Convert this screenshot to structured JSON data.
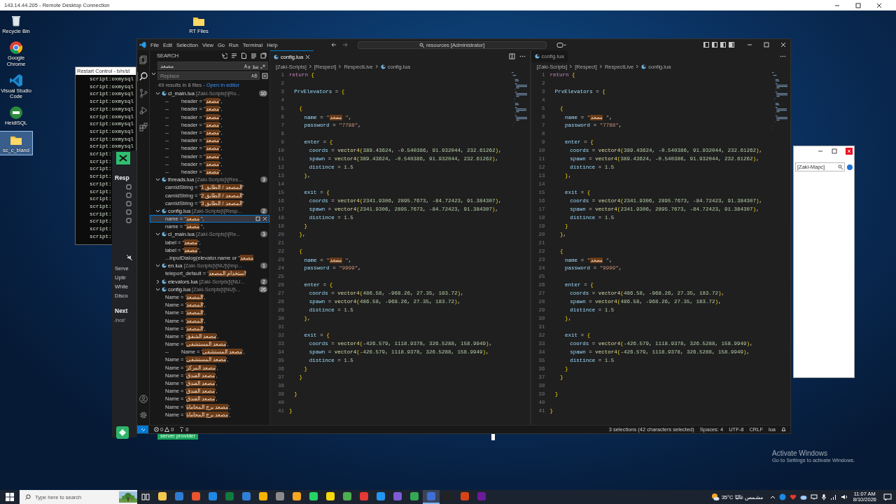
{
  "rdp": {
    "title": "143.14.44.205 - Remote Desktop Connection"
  },
  "desktop_icons": [
    {
      "label": "Recycle Bin",
      "kind": "recycle",
      "selected": false
    },
    {
      "label": "Google Chrome",
      "kind": "chrome",
      "selected": false
    },
    {
      "label": "Visual Studio Code",
      "kind": "vscode",
      "selected": false
    },
    {
      "label": "HeidiSQL",
      "kind": "heidi",
      "selected": false
    },
    {
      "label": "sc_c_bland",
      "kind": "folder",
      "selected": true
    }
  ],
  "desktop_folder": {
    "label": "RT Files"
  },
  "console_window": {
    "title": "Restart Control - b/n/st",
    "lines": [
      "script:oxmysql",
      "script:oxmysql",
      "script:oxmysql",
      "script:oxmysql",
      "script:oxmysql",
      "script:oxmysql",
      "script:oxmysql",
      "script:oxmysql",
      "script:oxmysql",
      "script:oxmysql",
      "script:",
      "script:",
      "script:",
      "script:",
      "script:",
      "script:",
      "script:",
      "script:",
      "script:",
      "script:",
      "script:",
      "script:"
    ]
  },
  "browser_window": {
    "heading": "Resp",
    "items": [
      "Serve",
      "Uptir",
      "White",
      "Disco"
    ],
    "next": "Next",
    "path": "/not/"
  },
  "provider_bar": {
    "label": "server provider"
  },
  "dialog_window": {
    "field_value": "[Zaki-Mapc]"
  },
  "vscode": {
    "menu": [
      "File",
      "Edit",
      "Selection",
      "View",
      "Go",
      "Run",
      "Terminal",
      "Help"
    ],
    "command_center": "resources [Administrator]",
    "activity": [
      {
        "kind": "explorer",
        "selected": false
      },
      {
        "kind": "search",
        "selected": true
      },
      {
        "kind": "scm",
        "selected": false
      },
      {
        "kind": "debug",
        "selected": false
      },
      {
        "kind": "extensions",
        "selected": false
      }
    ],
    "search": {
      "title": "SEARCH",
      "query": "مصعد",
      "replace_placeholder": "Replace",
      "summary": "49 results in 8 files - ",
      "open_link": "Open in editor",
      "files": [
        {
          "name": "cl_main.lua",
          "path": "[Zaki-Scripts]\\[Ro...",
          "count": "10",
          "expanded": true,
          "matches": [
            {
              "prefix": "--",
              "text": "header = \"مصعد\",",
              "selected": false
            },
            {
              "prefix": "--",
              "text": "header = \"مصعد\",",
              "selected": false
            },
            {
              "prefix": "--",
              "text": "header = \"مصعد\",",
              "selected": false
            },
            {
              "prefix": "--",
              "text": "header = \"مصعد\",",
              "selected": false
            },
            {
              "prefix": "--",
              "text": "header = \"مصعد\",",
              "selected": false
            },
            {
              "prefix": "--",
              "text": "header = \"مصعد\",",
              "selected": false
            },
            {
              "prefix": "--",
              "text": "header = \"مصعد\",",
              "selected": false
            },
            {
              "prefix": "--",
              "text": "header = \"مصعد\",",
              "selected": false
            },
            {
              "prefix": "--",
              "text": "header = \"مصعد\",",
              "selected": false
            },
            {
              "prefix": "--",
              "text": "header = \"مصعد\",",
              "selected": false
            }
          ]
        },
        {
          "name": "threads.lua",
          "path": "[Zaki-Scripts]\\[Res...",
          "count": "3",
          "expanded": true,
          "matches": [
            {
              "text": "camIdString = \"المصعد / الطابق 1\"",
              "selected": false
            },
            {
              "text": "camIdString = \"المصعد / الطابق 2\"",
              "selected": false
            },
            {
              "text": "camIdString = \"المصعد / الطابق 3\"",
              "selected": false
            }
          ]
        },
        {
          "name": "config.lua",
          "path": "[Zaki-Scripts]\\[Resp...",
          "count": "2",
          "expanded": true,
          "matches": [
            {
              "text": "name = \"مصعد \",",
              "selected": true
            },
            {
              "text": "name = \"مصعد \",",
              "selected": false
            }
          ]
        },
        {
          "name": "cl_main.lua",
          "path": "[Zaki-Scripts]\\[Re...",
          "count": "3",
          "expanded": true,
          "matches": [
            {
              "text": "label = \"مصعد\",",
              "selected": false
            },
            {
              "text": "label = \"مصعد\",",
              "selected": false
            },
            {
              "text": "...inputDialog(elevator.name or \"مصعد",
              "selected": false
            }
          ]
        },
        {
          "name": "en.lua",
          "path": "[Zaki-Scripts]\\[NU]\\[Imp...",
          "count": "1",
          "expanded": true,
          "matches": [
            {
              "text": "teleport_default = 'استخدام المصعد'",
              "selected": false
            }
          ]
        },
        {
          "name": "elevators.lua",
          "path": "[Zaki-Scripts]\\[NU...",
          "count": "2",
          "expanded": false
        },
        {
          "name": "config.lua",
          "path": "[Zaki-Scripts]\\[NU]\\...",
          "count": "26",
          "expanded": true,
          "matches": [
            {
              "text": "Name = 'المصعد',",
              "selected": false
            },
            {
              "text": "Name = 'المصعد',",
              "selected": false
            },
            {
              "text": "Name = 'المصعد',",
              "selected": false
            },
            {
              "text": "Name = 'المصعد',",
              "selected": false
            },
            {
              "text": "Name = 'المصعد',",
              "selected": false
            },
            {
              "text": "Name = 'مصعد الشقق',",
              "selected": false
            },
            {
              "text": "Name = 'مصعد المستشفى',",
              "selected": false
            },
            {
              "prefix": "--",
              "text": "Name = 'مصعد المستشفى',",
              "selected": false
            },
            {
              "text": "Name = 'مصعد المستشفى',",
              "selected": false
            },
            {
              "text": "Name = 'مصعد المركز',",
              "selected": false
            },
            {
              "text": "Name = 'مصعد الفندق',",
              "selected": false
            },
            {
              "text": "Name = 'مصعد الفندق',",
              "selected": false
            },
            {
              "text": "Name = 'مصعد الفندق',",
              "selected": false
            },
            {
              "text": "Name = 'مصعد الفندق',",
              "selected": false
            },
            {
              "text": "Name = 'مصعد برج المحاماة',",
              "selected": false
            },
            {
              "text": "Name = 'مصعد برج المحاماة',",
              "selected": false
            }
          ]
        }
      ]
    },
    "editors": [
      {
        "tab": {
          "label": "config.lua",
          "selected": true
        },
        "breadcrumbs": [
          "[Zaki-Scripts]",
          "[Respect]",
          "RespectLive",
          "config.lua"
        ],
        "lines": [
          {
            "n": "1",
            "code": "return {"
          },
          {
            "n": "2"
          },
          {
            "n": "3",
            "code": "    PrvElevators = {"
          },
          {
            "n": "4"
          },
          {
            "n": "5",
            "code": "        {"
          },
          {
            "n": "6",
            "code": "            name = \"مصعد \","
          },
          {
            "n": "7",
            "code": "            password = \"7788\","
          },
          {
            "n": "8"
          },
          {
            "n": "9",
            "code": "            enter = {"
          },
          {
            "n": "10",
            "code": "                coords = vector4(389.43624, -0.540386, 91.932044, 232.61262),"
          },
          {
            "n": "11",
            "code": "                spawn = vector4(389.43624, -0.540386, 91.932044, 232.61262),"
          },
          {
            "n": "12",
            "code": "                distince = 1.5"
          },
          {
            "n": "13",
            "code": "            },"
          },
          {
            "n": "14"
          },
          {
            "n": "15",
            "code": "            exit = {"
          },
          {
            "n": "16",
            "code": "                coords = vector4(2341.9306, 2895.7673, -84.72423, 91.384307),"
          },
          {
            "n": "17",
            "code": "                spawn = vector4(2341.9306, 2895.7673, -84.72423, 91.384307),"
          },
          {
            "n": "18",
            "code": "                distince = 1.5"
          },
          {
            "n": "19",
            "code": "            }"
          },
          {
            "n": "20",
            "code": "        },"
          },
          {
            "n": "21"
          },
          {
            "n": "22",
            "code": "        {"
          },
          {
            "n": "23",
            "code": "            name = \"مصعد \","
          },
          {
            "n": "24",
            "code": "            password = \"9999\","
          },
          {
            "n": "25"
          },
          {
            "n": "26",
            "code": "            enter = {"
          },
          {
            "n": "27",
            "code": "                coords = vector4(486.58, -968.26, 27.35, 183.72),"
          },
          {
            "n": "28",
            "code": "                spawn = vector4(486.58, -968.26, 27.35, 183.72),"
          },
          {
            "n": "29",
            "code": "                distince = 1.5"
          },
          {
            "n": "30",
            "code": "            },"
          },
          {
            "n": "31"
          },
          {
            "n": "32",
            "code": "            exit = {"
          },
          {
            "n": "33",
            "code": "                coords = vector4(-426.579, 1118.9378, 326.5288, 158.9949),"
          },
          {
            "n": "34",
            "code": "                spawn = vector4(-426.579, 1118.9378, 326.5288, 158.9949),"
          },
          {
            "n": "35",
            "code": "                distince = 1.5"
          },
          {
            "n": "36",
            "code": "            }"
          },
          {
            "n": "37",
            "code": "        }"
          },
          {
            "n": "38"
          },
          {
            "n": "39",
            "code": "    }"
          },
          {
            "n": "40"
          },
          {
            "n": "41",
            "code": "}"
          }
        ]
      },
      {
        "tab": {
          "label": "config.lua",
          "selected": false
        },
        "breadcrumbs": [
          "[Zaki-Scripts]",
          "[Respect]",
          "RespectLive",
          "config.lua"
        ],
        "lines": [
          {
            "n": "1",
            "code": "return {"
          },
          {
            "n": "2"
          },
          {
            "n": "3",
            "code": "    PrvElevators = {"
          },
          {
            "n": "4"
          },
          {
            "n": "5",
            "code": "        {"
          },
          {
            "n": "6",
            "code": "            name = \"مصعد \","
          },
          {
            "n": "7",
            "code": "            password = \"7788\","
          },
          {
            "n": "8"
          },
          {
            "n": "9",
            "code": "            enter = {"
          },
          {
            "n": "10",
            "code": "                coords = vector4(389.43624, -0.540386, 91.932044, 232.61262),"
          },
          {
            "n": "11",
            "code": "                spawn = vector4(389.43624, -0.540386, 91.932044, 232.61262),"
          },
          {
            "n": "12",
            "code": "                distince = 1.5"
          },
          {
            "n": "13",
            "code": "            },"
          },
          {
            "n": "14"
          },
          {
            "n": "15",
            "code": "            exit = {"
          },
          {
            "n": "16",
            "code": "                coords = vector4(2341.9306, 2895.7673, -84.72423, 91.384307),"
          },
          {
            "n": "17",
            "code": "                spawn = vector4(2341.9306, 2895.7673, -84.72423, 91.384307),"
          },
          {
            "n": "18",
            "code": "                distince = 1.5"
          },
          {
            "n": "19",
            "code": "            }"
          },
          {
            "n": "20",
            "code": "        },"
          },
          {
            "n": "21"
          },
          {
            "n": "22",
            "code": "        {"
          },
          {
            "n": "23",
            "code": "            name = \"مصعد \","
          },
          {
            "n": "24",
            "code": "            password = \"9999\","
          },
          {
            "n": "25"
          },
          {
            "n": "26",
            "code": "            enter = {"
          },
          {
            "n": "27",
            "code": "                coords = vector4(486.58, -968.26, 27.35, 183.72),"
          },
          {
            "n": "28",
            "code": "                spawn = vector4(486.58, -968.26, 27.35, 183.72),"
          },
          {
            "n": "29",
            "code": "                distince = 1.5"
          },
          {
            "n": "30",
            "code": "            },"
          },
          {
            "n": "31"
          },
          {
            "n": "32",
            "code": "            exit = {"
          },
          {
            "n": "33",
            "code": "                coords = vector4(-426.579, 1118.9378, 326.5288, 158.9949),"
          },
          {
            "n": "34",
            "code": "                spawn = vector4(-426.579, 1118.9378, 326.5288, 158.9949),"
          },
          {
            "n": "35",
            "code": "                distince = 1.5"
          },
          {
            "n": "36",
            "code": "            }"
          },
          {
            "n": "37",
            "code": "        }"
          },
          {
            "n": "38"
          },
          {
            "n": "39",
            "code": "    }"
          },
          {
            "n": "40"
          },
          {
            "n": "41",
            "code": "}"
          }
        ]
      }
    ],
    "status_bar": {
      "errors": "0",
      "warnings": "0",
      "ports": "0",
      "selection": "3 selections (42 characters selected)",
      "indent": "Spaces: 4",
      "encoding": "UTF-8",
      "eol": "CRLF",
      "language": "lua"
    }
  },
  "activation": {
    "title": "Activate Windows",
    "text": "Go to Settings to activate Windows."
  },
  "taskbar": {
    "search_placeholder": "Type here to search",
    "apps": [
      {
        "color": "#f2c94c",
        "selected": false
      },
      {
        "color": "#2d7dd2",
        "selected": false
      },
      {
        "color": "#e8542f",
        "selected": false
      },
      {
        "color": "#1e88e5",
        "selected": false
      },
      {
        "color": "#0f7b3f",
        "selected": false
      },
      {
        "color": "#2f7fd9",
        "selected": false
      },
      {
        "color": "#f4b400",
        "selected": false
      },
      {
        "color": "#8a8a8a",
        "selected": false
      },
      {
        "color": "#f5a623",
        "selected": false
      },
      {
        "color": "#25d366",
        "selected": false
      },
      {
        "color": "#f5d90a",
        "selected": false
      },
      {
        "color": "#4caf50",
        "selected": false
      },
      {
        "color": "#e53935",
        "selected": false
      },
      {
        "color": "#2196f3",
        "selected": false
      },
      {
        "color": "#7b5cd6",
        "selected": false
      },
      {
        "color": "#34a853",
        "selected": false
      },
      {
        "color": "#3d6fd8",
        "selected": true
      },
      {
        "color": "#222222",
        "selected": false
      },
      {
        "color": "#d84315",
        "selected": false
      },
      {
        "color": "#6a1b9a",
        "selected": false
      }
    ],
    "weather": "35°C مشمس غالبًا",
    "time": "11:07 AM",
    "date": "8/10/2026"
  }
}
